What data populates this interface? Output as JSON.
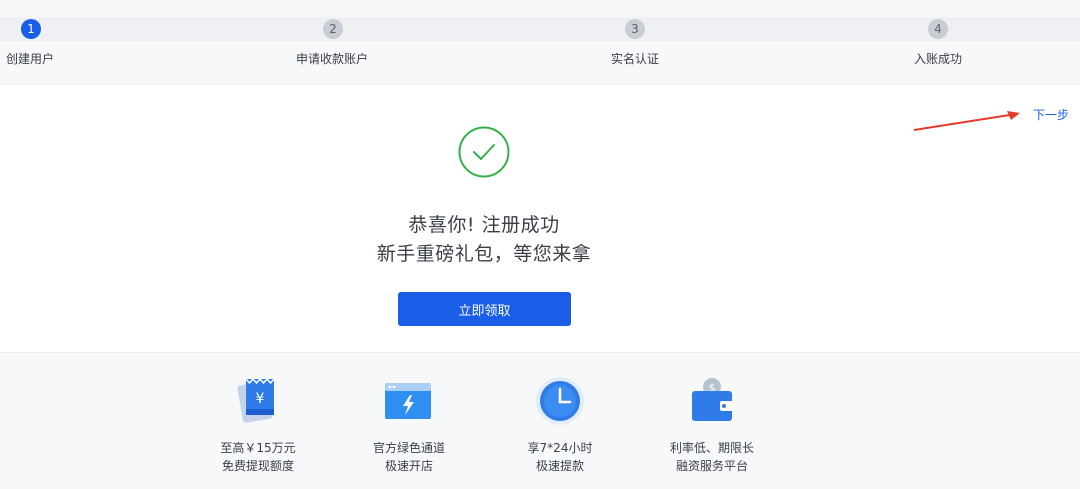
{
  "stepper": {
    "steps": [
      {
        "number": "1",
        "label": "创建用户",
        "active": true
      },
      {
        "number": "2",
        "label": "申请收款账户",
        "active": false
      },
      {
        "number": "3",
        "label": "实名认证",
        "active": false
      },
      {
        "number": "4",
        "label": "入账成功",
        "active": false
      }
    ]
  },
  "next_link": "下一步",
  "success": {
    "line1": "恭喜你! 注册成功",
    "line2": "新手重磅礼包，等您来拿"
  },
  "claim_button": "立即领取",
  "features": [
    {
      "icon": "ticket-yuan-icon",
      "line1": "至高￥15万元",
      "line2": "免费提现额度"
    },
    {
      "icon": "browser-lightning-icon",
      "line1": "官方绿色通道",
      "line2": "极速开店"
    },
    {
      "icon": "clock-icon",
      "line1": "享7*24小时",
      "line2": "极速提款"
    },
    {
      "icon": "wallet-dollar-icon",
      "line1": "利率低、期限长",
      "line2": "融资服务平台"
    }
  ],
  "colors": {
    "accent": "#1a5ee8",
    "success": "#2db34a",
    "annotation_arrow": "#e53b2e"
  }
}
